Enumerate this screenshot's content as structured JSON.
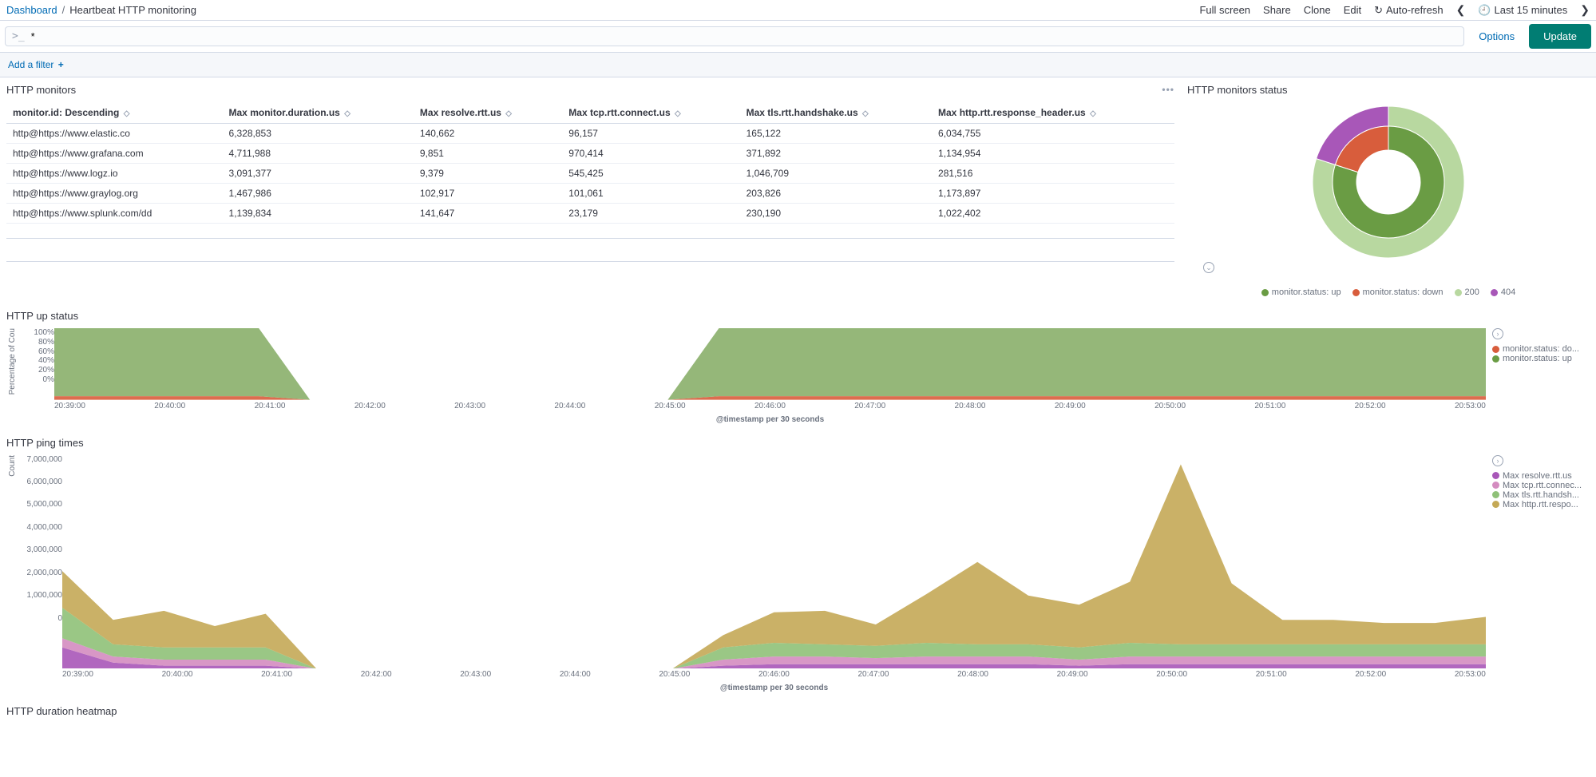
{
  "breadcrumb": {
    "root": "Dashboard",
    "sep": "/",
    "current": "Heartbeat HTTP monitoring"
  },
  "topActions": {
    "fullscreen": "Full screen",
    "share": "Share",
    "clone": "Clone",
    "edit": "Edit",
    "autorefresh": "Auto-refresh",
    "timerange": "Last 15 minutes"
  },
  "queryBar": {
    "prompt": ">_",
    "value": "*",
    "options": "Options",
    "update": "Update"
  },
  "filterBar": {
    "addFilter": "Add a filter",
    "plus": "+"
  },
  "panels": {
    "monitors": {
      "title": "HTTP monitors",
      "columns": [
        "monitor.id: Descending",
        "Max monitor.duration.us",
        "Max resolve.rtt.us",
        "Max tcp.rtt.connect.us",
        "Max tls.rtt.handshake.us",
        "Max http.rtt.response_header.us"
      ],
      "rows": [
        [
          "http@https://www.elastic.co",
          "6,328,853",
          "140,662",
          "96,157",
          "165,122",
          "6,034,755"
        ],
        [
          "http@https://www.grafana.com",
          "4,711,988",
          "9,851",
          "970,414",
          "371,892",
          "1,134,954"
        ],
        [
          "http@https://www.logz.io",
          "3,091,377",
          "9,379",
          "545,425",
          "1,046,709",
          "281,516"
        ],
        [
          "http@https://www.graylog.org",
          "1,467,986",
          "102,917",
          "101,061",
          "203,826",
          "1,173,897"
        ],
        [
          "http@https://www.splunk.com/dd",
          "1,139,834",
          "141,647",
          "23,179",
          "230,190",
          "1,022,402"
        ]
      ]
    },
    "status": {
      "title": "HTTP monitors status",
      "legend": [
        {
          "label": "monitor.status: up",
          "color": "#6a9c44"
        },
        {
          "label": "monitor.status: down",
          "color": "#d85d3c"
        },
        {
          "label": "200",
          "color": "#b8d8a0"
        },
        {
          "label": "404",
          "color": "#a857b8"
        }
      ]
    },
    "upstatus": {
      "title": "HTTP up status",
      "ylabel": "Percentage of Cou",
      "xlabel": "@timestamp per 30 seconds",
      "legend": [
        {
          "label": "monitor.status: do...",
          "color": "#d85d3c"
        },
        {
          "label": "monitor.status: up",
          "color": "#6a9c44"
        }
      ]
    },
    "pingtimes": {
      "title": "HTTP ping times",
      "ylabel": "Count",
      "xlabel": "@timestamp per 30 seconds",
      "legend": [
        {
          "label": "Max resolve.rtt.us",
          "color": "#a857b8"
        },
        {
          "label": "Max tcp.rtt.connec...",
          "color": "#d48cc0"
        },
        {
          "label": "Max tls.rtt.handsh...",
          "color": "#8fc178"
        },
        {
          "label": "Max http.rtt.respo...",
          "color": "#c4a956"
        }
      ]
    },
    "heatmap": {
      "title": "HTTP duration heatmap"
    }
  },
  "chart_data": [
    {
      "type": "pie",
      "title": "HTTP monitors status",
      "rings": [
        {
          "name": "inner",
          "slices": [
            {
              "label": "monitor.status: up",
              "value": 80,
              "color": "#6a9c44"
            },
            {
              "label": "monitor.status: down",
              "value": 20,
              "color": "#d85d3c"
            }
          ]
        },
        {
          "name": "outer",
          "slices": [
            {
              "label": "200",
              "value": 80,
              "color": "#b8d8a0"
            },
            {
              "label": "404",
              "value": 20,
              "color": "#a857b8"
            }
          ]
        }
      ]
    },
    {
      "type": "area",
      "title": "HTTP up status",
      "stacked": true,
      "ylim": [
        0,
        100
      ],
      "xlabel": "@timestamp per 30 seconds",
      "ylabel": "Percentage of Count",
      "x_ticks": [
        "20:39:00",
        "20:40:00",
        "20:41:00",
        "20:42:00",
        "20:43:00",
        "20:44:00",
        "20:45:00",
        "20:46:00",
        "20:47:00",
        "20:48:00",
        "20:49:00",
        "20:50:00",
        "20:51:00",
        "20:52:00",
        "20:53:00"
      ],
      "y_ticks": [
        "0%",
        "20%",
        "40%",
        "60%",
        "80%",
        "100%"
      ],
      "series": [
        {
          "name": "monitor.status: down",
          "color": "#d85d3c",
          "values": [
            5,
            5,
            5,
            5,
            5,
            0,
            0,
            0,
            0,
            0,
            0,
            0,
            0,
            5,
            5,
            5,
            5,
            5,
            5,
            5,
            5,
            5,
            5,
            5,
            5,
            5,
            5,
            5,
            5
          ]
        },
        {
          "name": "monitor.status: up",
          "color": "#8aaf6a",
          "values": [
            95,
            95,
            95,
            95,
            95,
            0,
            0,
            0,
            0,
            0,
            0,
            0,
            0,
            95,
            95,
            95,
            95,
            95,
            95,
            95,
            95,
            95,
            95,
            95,
            95,
            95,
            95,
            95,
            95
          ]
        }
      ]
    },
    {
      "type": "area",
      "title": "HTTP ping times",
      "stacked": true,
      "ylim": [
        0,
        7000000
      ],
      "xlabel": "@timestamp per 30 seconds",
      "ylabel": "Count",
      "x_ticks": [
        "20:39:00",
        "20:40:00",
        "20:41:00",
        "20:42:00",
        "20:43:00",
        "20:44:00",
        "20:45:00",
        "20:46:00",
        "20:47:00",
        "20:48:00",
        "20:49:00",
        "20:50:00",
        "20:51:00",
        "20:52:00",
        "20:53:00"
      ],
      "y_ticks": [
        "0",
        "1,000,000",
        "2,000,000",
        "3,000,000",
        "4,000,000",
        "5,000,000",
        "6,000,000",
        "7,000,000"
      ],
      "series": [
        {
          "name": "Max resolve.rtt.us",
          "color": "#a857b8",
          "values": [
            700000,
            200000,
            100000,
            100000,
            100000,
            0,
            0,
            0,
            0,
            0,
            0,
            0,
            0,
            100000,
            150000,
            150000,
            150000,
            150000,
            150000,
            150000,
            100000,
            150000,
            150000,
            150000,
            150000,
            150000,
            150000,
            150000,
            150000
          ]
        },
        {
          "name": "Max tcp.rtt.connect.us",
          "color": "#d48cc0",
          "values": [
            300000,
            200000,
            200000,
            200000,
            200000,
            0,
            0,
            0,
            0,
            0,
            0,
            0,
            0,
            200000,
            250000,
            250000,
            200000,
            250000,
            250000,
            250000,
            200000,
            250000,
            250000,
            250000,
            250000,
            250000,
            250000,
            250000,
            250000
          ]
        },
        {
          "name": "Max tls.rtt.handshake.us",
          "color": "#8fc178",
          "values": [
            1000000,
            400000,
            400000,
            400000,
            400000,
            0,
            0,
            0,
            0,
            0,
            0,
            0,
            0,
            400000,
            450000,
            400000,
            400000,
            450000,
            400000,
            400000,
            400000,
            450000,
            400000,
            400000,
            400000,
            400000,
            400000,
            400000,
            400000
          ]
        },
        {
          "name": "Max http.rtt.response_header.us",
          "color": "#c4a956",
          "values": [
            1200000,
            800000,
            1200000,
            700000,
            1100000,
            0,
            0,
            0,
            0,
            0,
            0,
            0,
            0,
            400000,
            1000000,
            1100000,
            700000,
            1600000,
            2700000,
            1600000,
            1400000,
            2000000,
            5900000,
            2000000,
            800000,
            800000,
            700000,
            700000,
            900000
          ]
        }
      ]
    }
  ]
}
